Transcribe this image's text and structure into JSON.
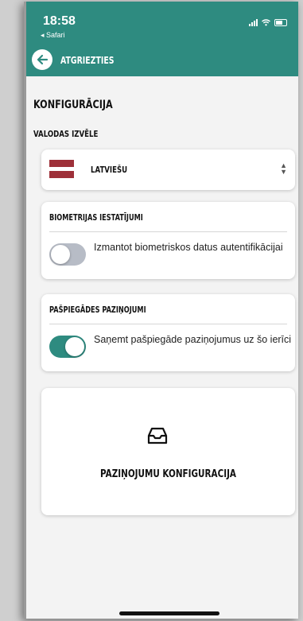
{
  "status_bar": {
    "time": "18:58",
    "back_app": "◂ Safari"
  },
  "nav": {
    "back_label": "ATGRIEZTIES"
  },
  "page": {
    "title": "KONFIGURĀCIJA"
  },
  "language": {
    "section_label": "VALODAS IZVĒLE",
    "selected": "LATVIEŠU",
    "flag_colors": [
      "#9e3039",
      "#ffffff",
      "#9e3039"
    ]
  },
  "biometrics": {
    "heading": "BIOMETRIJAS IESTATĪJUMI",
    "toggle_text": "Izmantot biometriskos datus autentifikācijai",
    "toggle_on": false
  },
  "push": {
    "heading": "PAŠPIEGĀDES PAZIŅOJUMI",
    "toggle_text": "Saņemt pašpiegāde paziņojumus uz šo ierīci",
    "toggle_on": true
  },
  "notifications": {
    "label": "PAZIŅOJUMU KONFIGURĀCIJA",
    "icon": "inbox-icon"
  },
  "colors": {
    "accent": "#2e8b80",
    "toggle_off": "#b7bcc6"
  }
}
